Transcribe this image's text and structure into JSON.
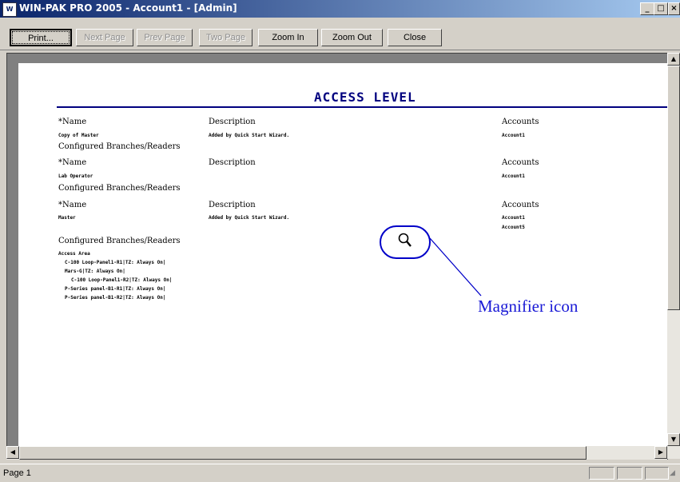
{
  "window": {
    "title": "WIN-PAK PRO 2005 - Account1 - [Admin]",
    "app_icon": "app-icon",
    "controls": [
      "_",
      "□",
      "×"
    ]
  },
  "toolbar": {
    "print_label": "Print...",
    "next_page_label": "Next Page",
    "prev_page_label": "Prev Page",
    "two_page_label": "Two Page",
    "zoom_in_label": "Zoom In",
    "zoom_out_label": "Zoom Out",
    "close_label": "Close"
  },
  "report": {
    "title": "ACCESS LEVEL",
    "col_name": "*Name",
    "col_description": "Description",
    "col_accounts": "Accounts",
    "configured_label": "Configured Branches/Readers",
    "records": [
      {
        "name": "Copy of Master",
        "description": "Added by Quick Start Wizard.",
        "accounts": [
          "Account1"
        ]
      },
      {
        "name": "Lab Operator",
        "description": "",
        "accounts": [
          "Account1"
        ]
      },
      {
        "name": "Master",
        "description": "Added by Quick Start Wizard.",
        "accounts": [
          "Account1",
          "Account5"
        ]
      }
    ],
    "access_area_label": "Access Area",
    "access_items": [
      "C-100 Loop-Panel1-R1|TZ: Always On|",
      "Mars-G|TZ: Always On|",
      "C-100 Loop-Panel1-R2|TZ: Always On|",
      "P-Series panel-B1-R1|TZ: Always On|",
      "P-Series panel-B1-R2|TZ: Always On|"
    ]
  },
  "annotation": {
    "label": "Magnifier icon",
    "icon": "magnifier-icon",
    "color": "#1a1ad6"
  },
  "status": {
    "page_label": "Page 1"
  }
}
